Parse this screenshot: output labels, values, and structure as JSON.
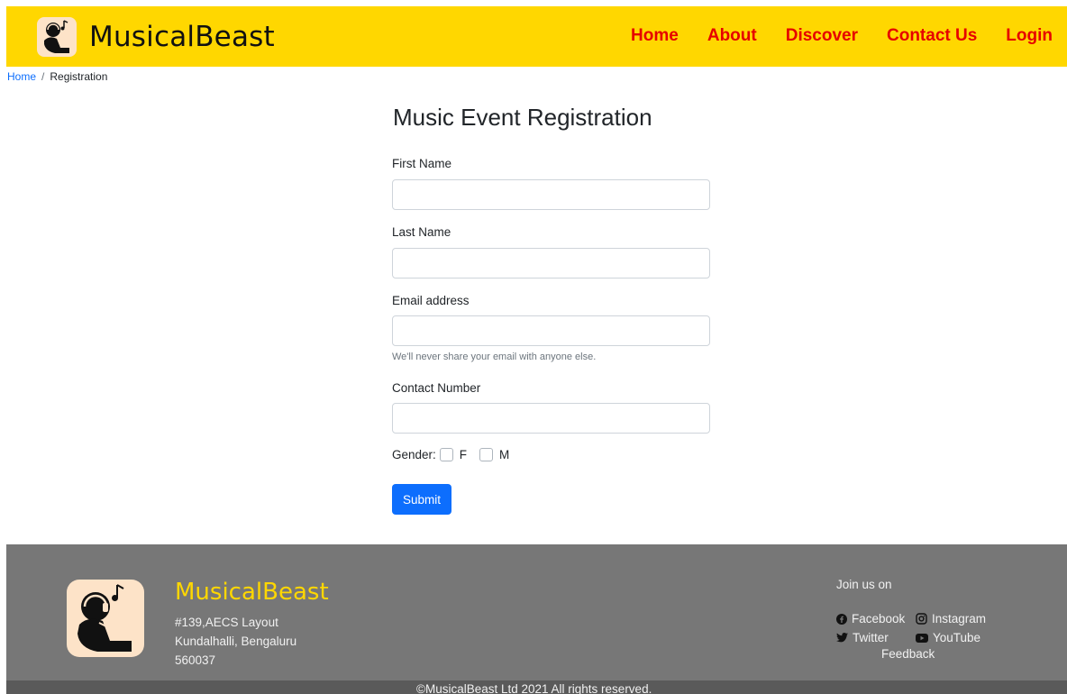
{
  "header": {
    "brand": "MusicalBeast",
    "nav": [
      "Home",
      "About",
      "Discover",
      "Contact Us",
      "Login"
    ]
  },
  "breadcrumb": {
    "home": "Home",
    "separator": "/",
    "current": "Registration"
  },
  "form": {
    "title": "Music Event Registration",
    "first_name_label": "First Name",
    "last_name_label": "Last Name",
    "email_label": "Email address",
    "email_help": "We'll never share your email with anyone else.",
    "contact_label": "Contact Number",
    "gender_label": "Gender:",
    "gender_f": "F",
    "gender_m": "M",
    "submit_label": "Submit"
  },
  "footer": {
    "brand": "MusicalBeast",
    "address_line1": "#139,AECS Layout",
    "address_line2": "Kundalhalli, Bengaluru",
    "address_line3": "560037",
    "join_label": "Join us on",
    "facebook": "Facebook",
    "instagram": "Instagram",
    "twitter": "Twitter",
    "youtube": "YouTube",
    "feedback": "Feedback",
    "copyright": "©MusicalBeast Ltd 2021 All rights reserved."
  },
  "colors": {
    "header_bg": "#ffd700",
    "nav_link": "#e60000",
    "footer_bg": "#777777",
    "footer_brand": "#ffd700",
    "button": "#0d6efd"
  }
}
